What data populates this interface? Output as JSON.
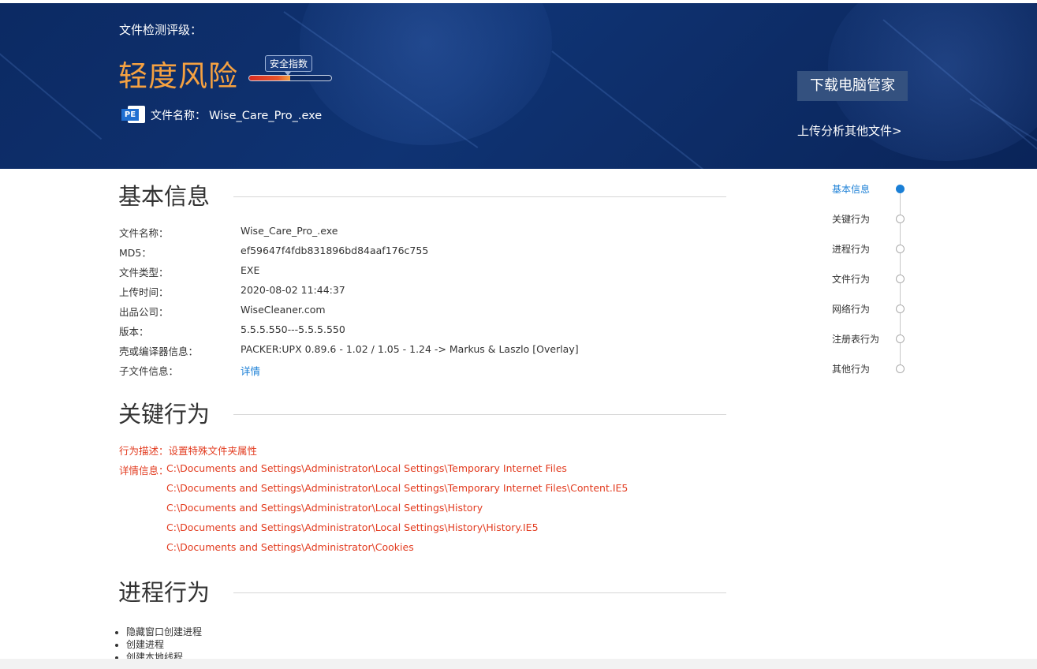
{
  "header": {
    "rating_label": "文件检测评级：",
    "risk_level": "轻度风险",
    "safety_tip": "安全指数",
    "safety_level": 0.5,
    "file_icon": "PE",
    "file_name_label": "文件名称：",
    "file_name": "Wise_Care_Pro_.exe",
    "download_button": "下载电脑管家",
    "upload_link": "上传分析其他文件>",
    "colors": {
      "banner": "#0f3373",
      "risk": "#f5a141",
      "accent": "#1a7fd6"
    }
  },
  "basic_info": {
    "title": "基本信息",
    "rows": [
      {
        "key": "文件名称：",
        "value": "Wise_Care_Pro_.exe"
      },
      {
        "key": "MD5：",
        "value": "ef59647f4fdb831896bd84aaf176c755"
      },
      {
        "key": "文件类型：",
        "value": "EXE"
      },
      {
        "key": "上传时间：",
        "value": "2020-08-02 11:44:37"
      },
      {
        "key": "出品公司：",
        "value": "WiseCleaner.com"
      },
      {
        "key": "版本：",
        "value": "5.5.5.550---5.5.5.550"
      },
      {
        "key": "壳或编译器信息：",
        "value": "PACKER:UPX 0.89.6 - 1.02 / 1.05 - 1.24 -> Markus & Laszlo [Overlay]"
      },
      {
        "key": "子文件信息：",
        "value": "详情"
      }
    ]
  },
  "key_behavior": {
    "title": "关键行为",
    "desc_label": "行为描述：",
    "desc_value": "设置特殊文件夹属性",
    "detail_label": "详情信息：",
    "details": [
      "C:\\Documents and Settings\\Administrator\\Local Settings\\Temporary Internet Files",
      "C:\\Documents and Settings\\Administrator\\Local Settings\\Temporary Internet Files\\Content.IE5",
      "C:\\Documents and Settings\\Administrator\\Local Settings\\History",
      "C:\\Documents and Settings\\Administrator\\Local Settings\\History\\History.IE5",
      "C:\\Documents and Settings\\Administrator\\Cookies"
    ]
  },
  "process_behavior": {
    "title": "进程行为",
    "items": [
      "隐藏窗口创建进程",
      "创建进程",
      "创建本地线程"
    ]
  },
  "side_nav": {
    "items": [
      "基本信息",
      "关键行为",
      "进程行为",
      "文件行为",
      "网络行为",
      "注册表行为",
      "其他行为"
    ],
    "active": 0
  }
}
